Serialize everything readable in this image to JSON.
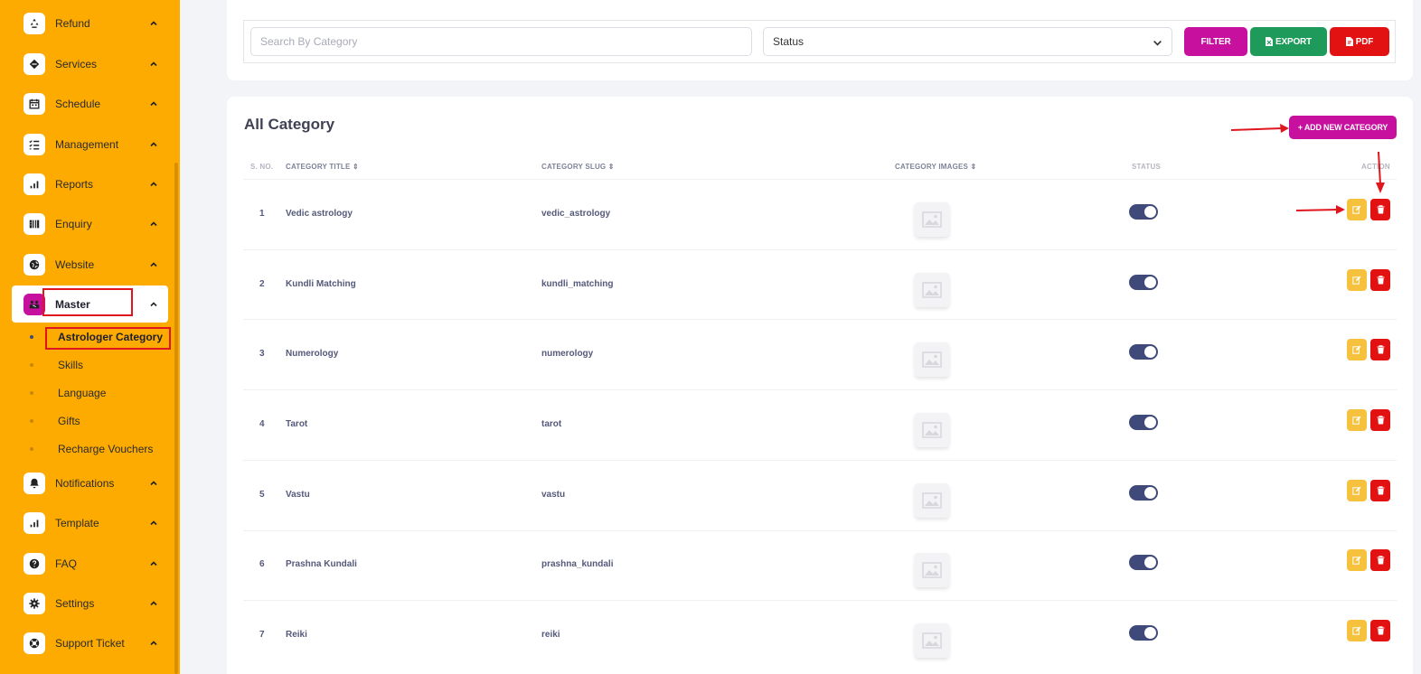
{
  "sidebar": {
    "items": [
      {
        "label": "Refund",
        "icon": "recycle-icon"
      },
      {
        "label": "Services",
        "icon": "layers-icon"
      },
      {
        "label": "Schedule",
        "icon": "calendar-icon"
      },
      {
        "label": "Management",
        "icon": "task-list-icon"
      },
      {
        "label": "Reports",
        "icon": "bar-chart-icon"
      },
      {
        "label": "Enquiry",
        "icon": "enquiry-icon"
      },
      {
        "label": "Website",
        "icon": "globe-icon"
      },
      {
        "label": "Master",
        "icon": "users-icon",
        "active": true
      },
      {
        "label": "Notifications",
        "icon": "bell-icon"
      },
      {
        "label": "Template",
        "icon": "bar-chart-icon"
      },
      {
        "label": "FAQ",
        "icon": "question-icon"
      },
      {
        "label": "Settings",
        "icon": "gear-icon"
      },
      {
        "label": "Support Ticket",
        "icon": "lifebuoy-icon"
      }
    ],
    "sub_items": [
      {
        "label": "Astrologer Category",
        "active": true
      },
      {
        "label": "Skills"
      },
      {
        "label": "Language"
      },
      {
        "label": "Gifts"
      },
      {
        "label": "Recharge Vouchers"
      }
    ]
  },
  "filter": {
    "search_placeholder": "Search By Category",
    "status_value": "Status",
    "filter_label": "FILTER",
    "export_label": "EXPORT",
    "pdf_label": "PDF"
  },
  "table": {
    "title": "All Category",
    "add_button_label": "+ ADD NEW CATEGORY",
    "columns": {
      "sno": "S. NO.",
      "title": "CATEGORY TITLE",
      "slug": "CATEGORY SLUG",
      "images": "CATEGORY IMAGES",
      "status": "STATUS",
      "action": "ACTION"
    },
    "rows": [
      {
        "sno": "1",
        "title": "Vedic astrology",
        "slug": "vedic_astrology",
        "status_on": true
      },
      {
        "sno": "2",
        "title": "Kundli Matching",
        "slug": "kundli_matching",
        "status_on": true
      },
      {
        "sno": "3",
        "title": "Numerology",
        "slug": "numerology",
        "status_on": true
      },
      {
        "sno": "4",
        "title": "Tarot",
        "slug": "tarot",
        "status_on": true
      },
      {
        "sno": "5",
        "title": "Vastu",
        "slug": "vastu",
        "status_on": true
      },
      {
        "sno": "6",
        "title": "Prashna Kundali",
        "slug": "prashna_kundali",
        "status_on": true
      },
      {
        "sno": "7",
        "title": "Reiki",
        "slug": "reiki",
        "status_on": true
      }
    ]
  },
  "colors": {
    "sidebar_bg": "#fdab00",
    "filter_btn": "#c7119e",
    "export_btn": "#1e9b5a",
    "pdf_btn": "#e31212",
    "toggle_on": "#3f4a7a",
    "edit_btn": "#f6c23e",
    "delete_btn": "#e31212",
    "annotation_red": "#e0161f"
  }
}
